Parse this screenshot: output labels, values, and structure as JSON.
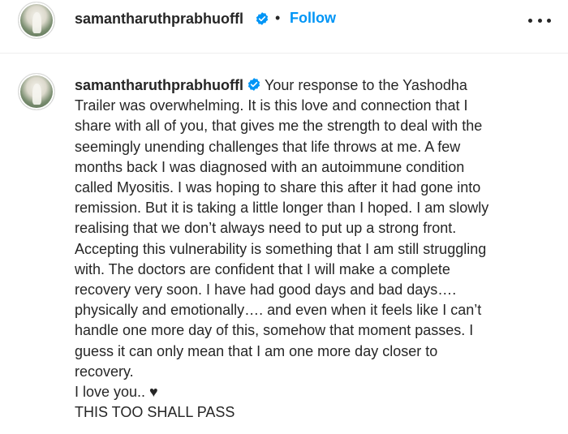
{
  "header": {
    "username": "samantharuthprabhuoffl",
    "separator": "•",
    "follow_label": "Follow",
    "more_icon": "more-horizontal-icon"
  },
  "post": {
    "username": "samantharuthprabhuoffl",
    "caption_lines": [
      "Your response to the Yashodha",
      "Trailer was overwhelming. It is this love and connection that I",
      "share with all of you, that gives me the strength to deal with the",
      "seemingly unending challenges that life throws at me. A few",
      "months back I was diagnosed with an autoimmune condition",
      "called Myositis. I was hoping to share this after it had gone into",
      "remission. But it is taking a little longer than I hoped. I am slowly",
      "realising that we don’t always need to put up a strong front.",
      "Accepting this vulnerability is something that I am still struggling",
      "with. The doctors are confident that I will make a complete",
      "recovery very soon. I have had good days and bad days….",
      "physically and emotionally…. and even when it feels like I can’t",
      "handle one more day of this, somehow that moment passes. I",
      "guess it can only mean that I am one more day closer to",
      "recovery.",
      "I love you.. ♥",
      "THIS TOO SHALL PASS"
    ]
  },
  "colors": {
    "text": "#262626",
    "accent": "#0095f6",
    "verified_badge": "#0095f6",
    "divider": "#efefef"
  }
}
